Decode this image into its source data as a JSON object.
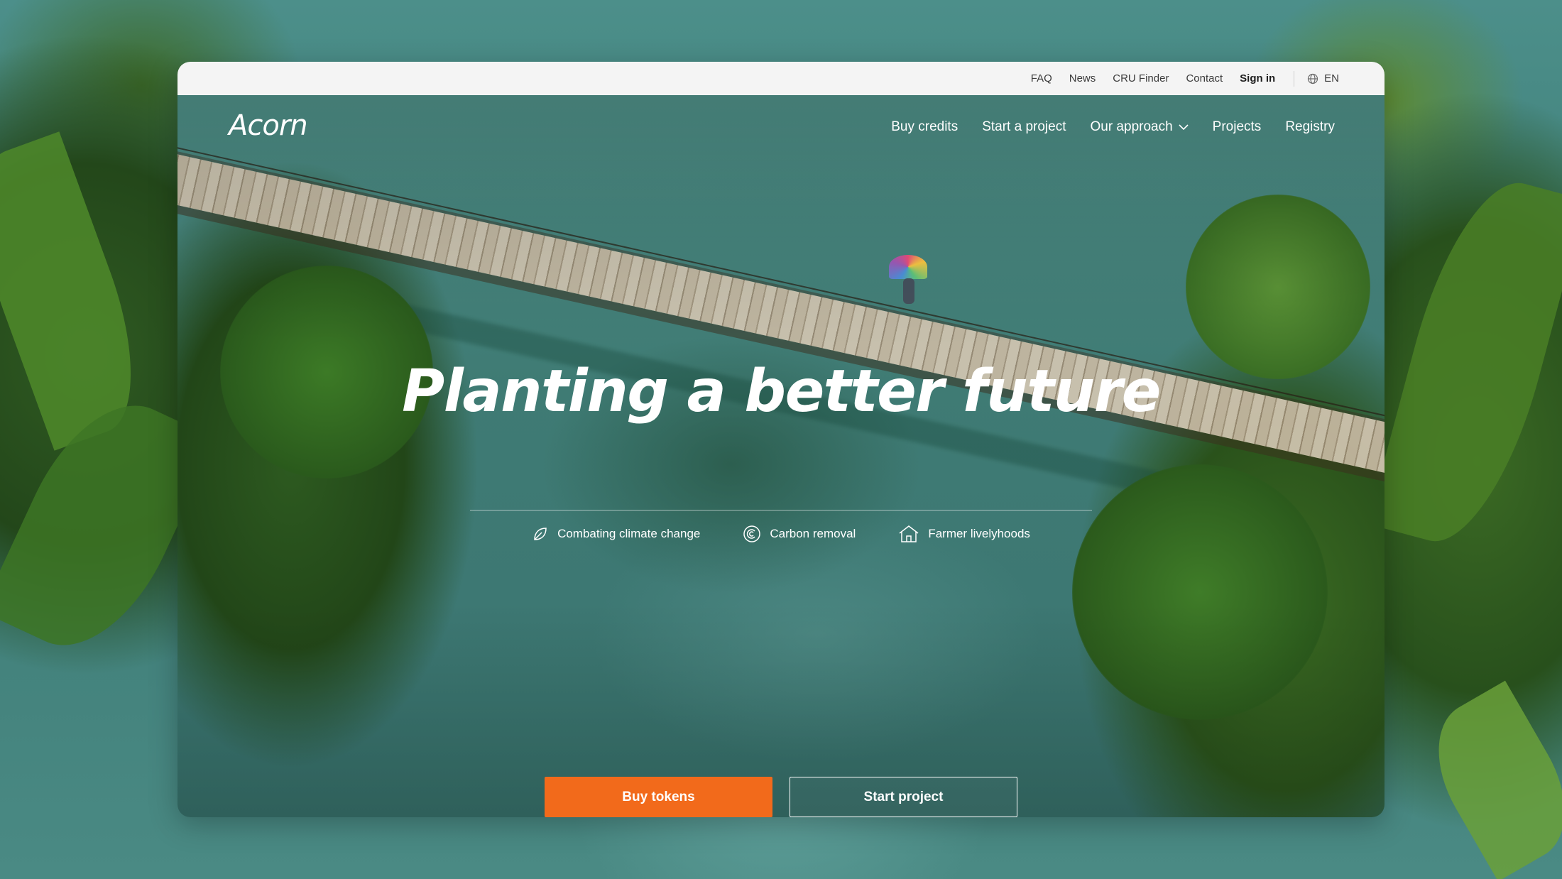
{
  "utility_nav": {
    "links": [
      "FAQ",
      "News",
      "CRU Finder",
      "Contact"
    ],
    "sign_in": "Sign in",
    "language": "EN",
    "language_icon": "globe-icon"
  },
  "brand": {
    "logo_text": "Acorn"
  },
  "main_nav": {
    "items": [
      "Buy credits",
      "Start a project",
      "Our approach",
      "Projects",
      "Registry"
    ],
    "dropdown_icon": "chevron-down-icon"
  },
  "hero": {
    "headline": "Planting a better future",
    "features": [
      {
        "label": "Combating climate change",
        "icon": "leaf-icon"
      },
      {
        "label": "Carbon removal",
        "icon": "carbon-cycle-icon"
      },
      {
        "label": "Farmer livelyhoods",
        "icon": "house-icon"
      }
    ],
    "cta_primary": "Buy tokens",
    "cta_secondary": "Start project"
  },
  "colors": {
    "accent": "#f26a1b",
    "topbar_bg": "#f4f4f4",
    "text_on_hero": "#ffffff"
  }
}
